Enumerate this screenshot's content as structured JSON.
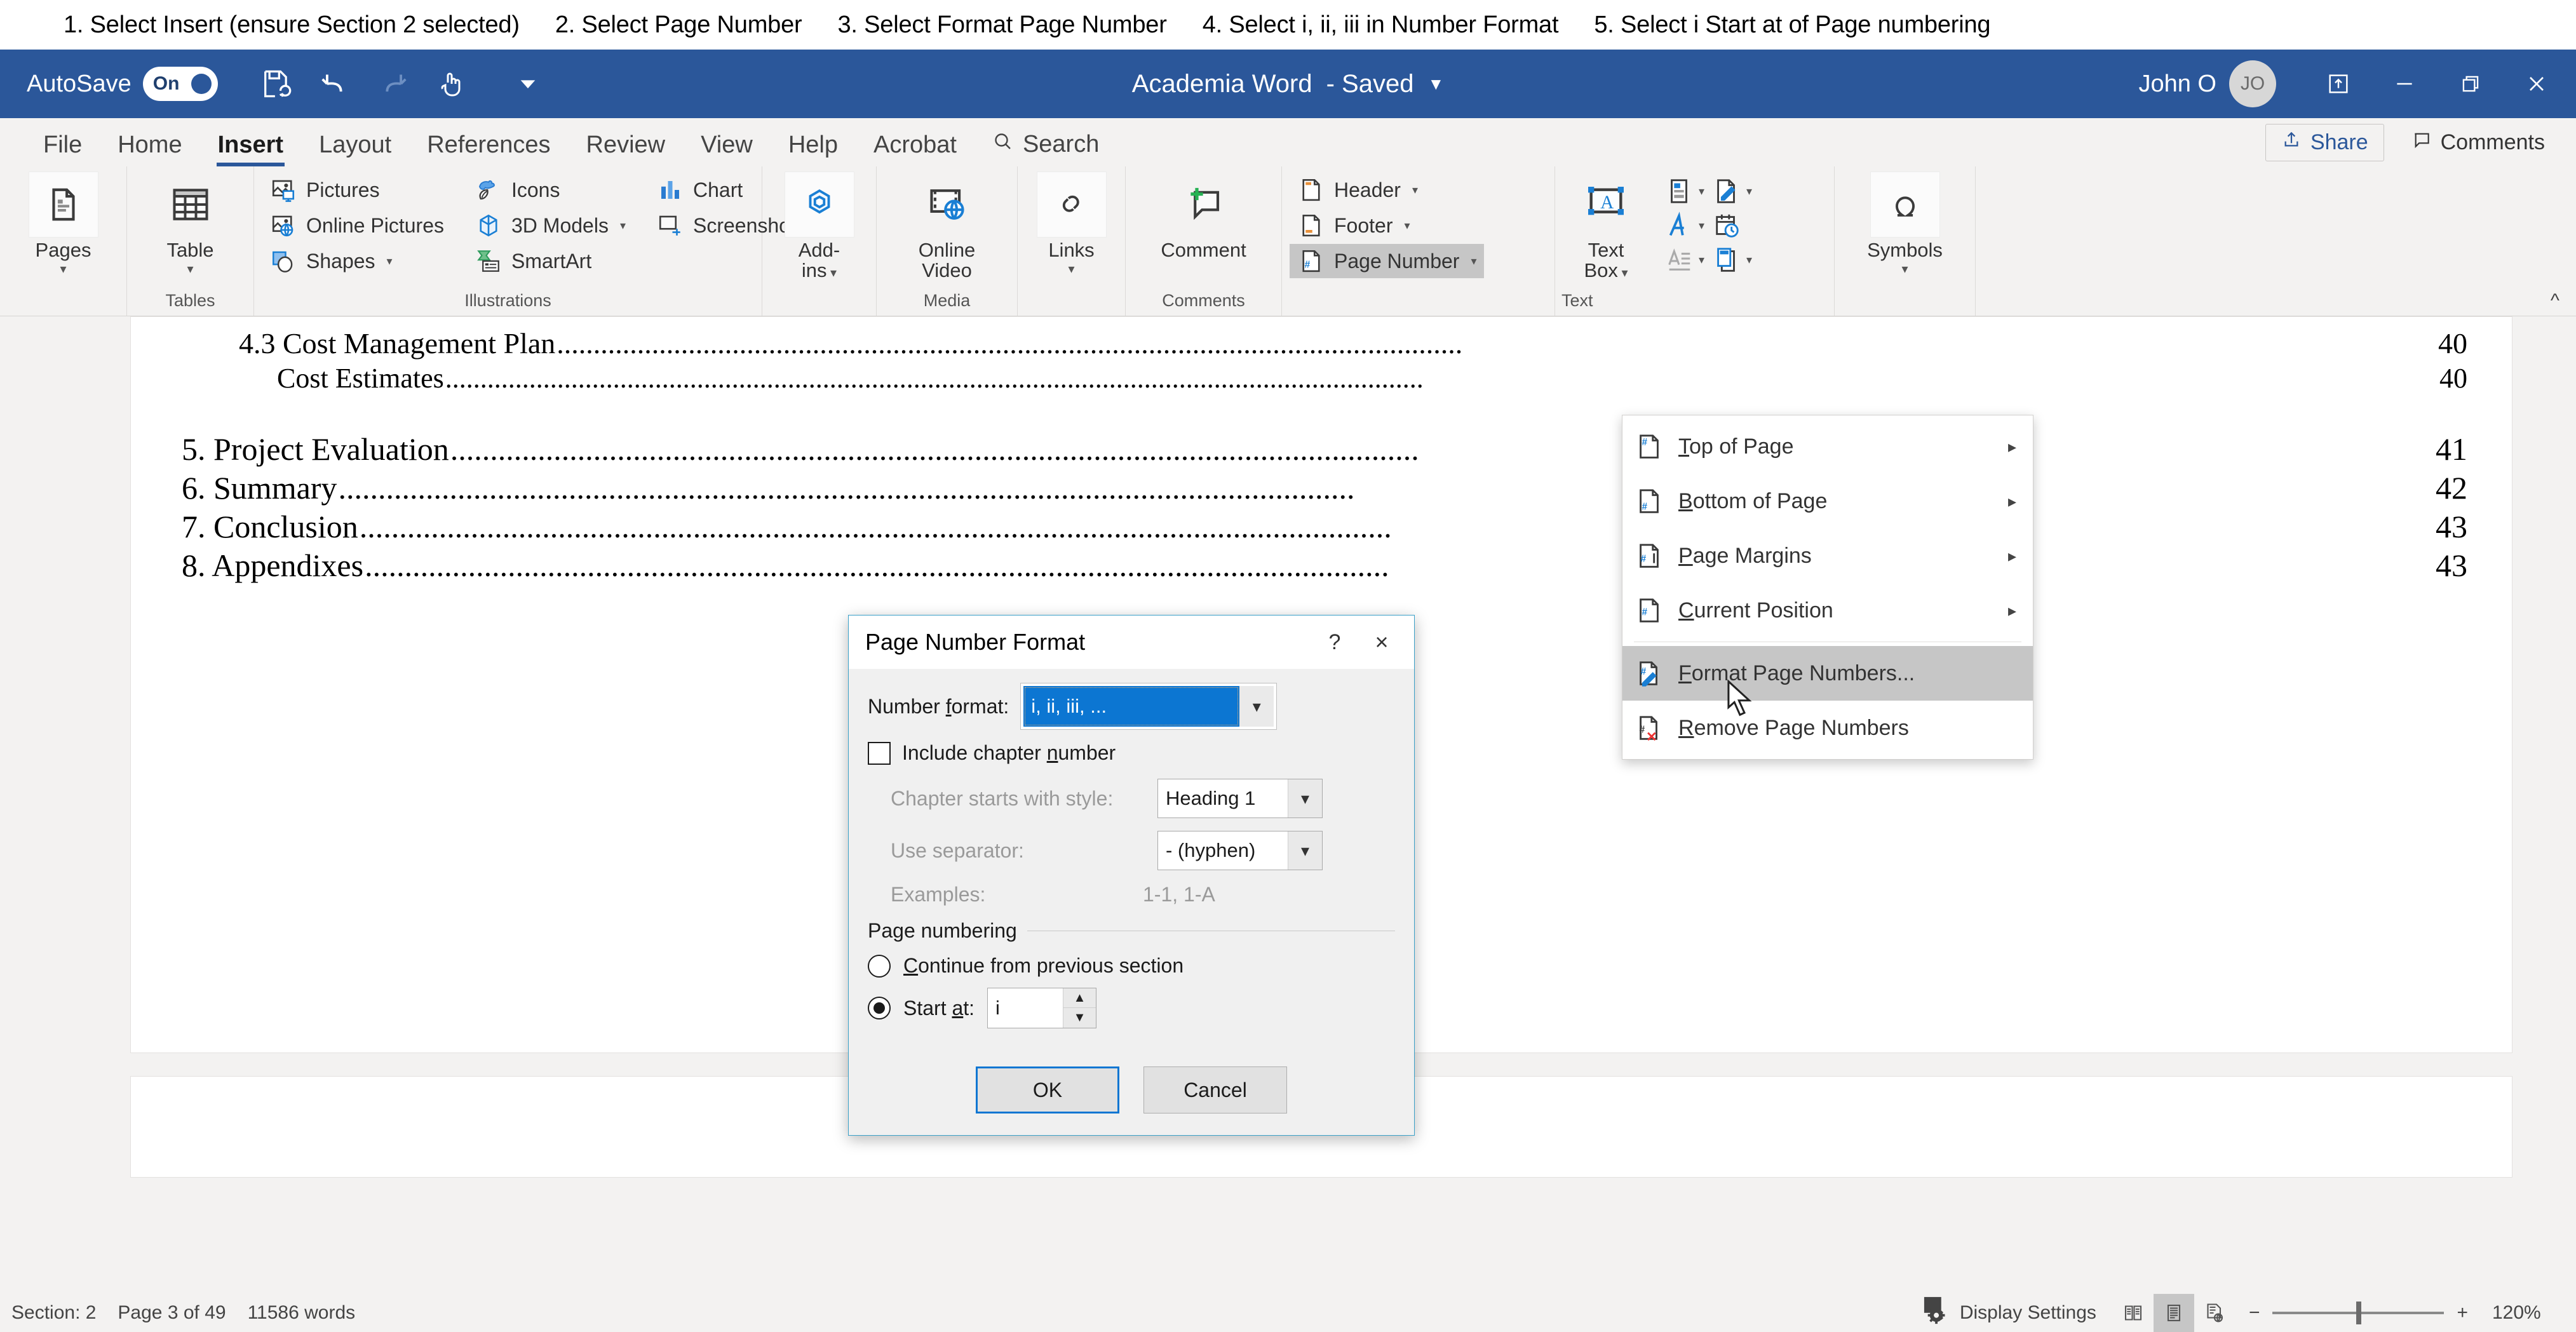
{
  "instructions": [
    "1. Select Insert (ensure Section 2 selected)",
    "2. Select Page Number",
    "3. Select Format Page Number",
    "4. Select i, ii, iii in Number Format",
    "5. Select i Start at of Page numbering"
  ],
  "titlebar": {
    "autosave_label": "AutoSave",
    "autosave_state": "On",
    "document_title": "Academia Word",
    "save_state": "- Saved",
    "user_name": "John O",
    "user_initials": "JO",
    "quick_access": [
      "save-icon",
      "undo-icon",
      "redo-icon",
      "touch-mode-icon",
      "customize-qat-icon"
    ],
    "window_buttons": [
      "ribbon-display-options-icon",
      "minimize-icon",
      "restore-icon",
      "close-icon"
    ]
  },
  "tabs": [
    {
      "label": "File",
      "active": false
    },
    {
      "label": "Home",
      "active": false
    },
    {
      "label": "Insert",
      "active": true
    },
    {
      "label": "Layout",
      "active": false
    },
    {
      "label": "References",
      "active": false
    },
    {
      "label": "Review",
      "active": false
    },
    {
      "label": "View",
      "active": false
    },
    {
      "label": "Help",
      "active": false
    },
    {
      "label": "Acrobat",
      "active": false
    }
  ],
  "search_label": "Search",
  "share_label": "Share",
  "comments_label": "Comments",
  "ribbon": {
    "groups": [
      {
        "label": "",
        "items": [
          {
            "label": "Pages",
            "icon": "pages-icon"
          }
        ]
      },
      {
        "label": "Tables",
        "items": [
          {
            "label": "Table",
            "icon": "table-icon"
          }
        ]
      },
      {
        "label": "Illustrations",
        "items": [
          {
            "label": "Pictures",
            "icon": "pictures-icon"
          },
          {
            "label": "Online Pictures",
            "icon": "online-pictures-icon"
          },
          {
            "label": "Shapes",
            "icon": "shapes-icon"
          },
          {
            "label": "Icons",
            "icon": "icons-icon"
          },
          {
            "label": "3D Models",
            "icon": "3d-models-icon"
          },
          {
            "label": "SmartArt",
            "icon": "smartart-icon"
          },
          {
            "label": "Chart",
            "icon": "chart-icon"
          },
          {
            "label": "Screenshot",
            "icon": "screenshot-icon"
          }
        ]
      },
      {
        "label": "",
        "items": [
          {
            "label": "Add-ins",
            "icon": "addins-icon"
          }
        ]
      },
      {
        "label": "Media",
        "items": [
          {
            "label": "Online Video",
            "icon": "online-video-icon"
          }
        ]
      },
      {
        "label": "",
        "items": [
          {
            "label": "Links",
            "icon": "links-icon"
          }
        ]
      },
      {
        "label": "Comments",
        "items": [
          {
            "label": "Comment",
            "icon": "comment-icon"
          }
        ]
      },
      {
        "label": "",
        "items": [
          {
            "label": "Header",
            "icon": "header-icon"
          },
          {
            "label": "Footer",
            "icon": "footer-icon"
          },
          {
            "label": "Page Number",
            "icon": "page-number-icon",
            "selected": true
          }
        ]
      },
      {
        "label": "Text",
        "items": [
          {
            "label": "Text Box",
            "icon": "text-box-icon"
          }
        ]
      },
      {
        "label": "",
        "items": [
          {
            "label": "Symbols",
            "icon": "omega-icon"
          }
        ]
      }
    ],
    "labels": {
      "pages": "Pages",
      "table": "Table",
      "tables_group": "Tables",
      "pictures": "Pictures",
      "online_pictures": "Online Pictures",
      "shapes": "Shapes",
      "icons": "Icons",
      "models3d": "3D Models",
      "smartart": "SmartArt",
      "chart": "Chart",
      "screenshot": "Screenshot",
      "illustrations_group": "Illustrations",
      "addins": "Add-­ins",
      "addins_l1": "Add-",
      "addins_l2": "ins",
      "online_video_l1": "Online",
      "online_video_l2": "Video",
      "media_group": "Media",
      "links": "Links",
      "comment": "Comment",
      "comments_group": "Comments",
      "header": "Header",
      "footer": "Footer",
      "page_number": "Page Number",
      "textbox_l1": "Text",
      "textbox_l2": "Box",
      "text_group": "Text",
      "symbols": "Symbols"
    }
  },
  "page_number_menu": {
    "items": [
      {
        "label": "Top of Page",
        "icon": "page-number-top-icon",
        "submenu": true,
        "selected": false
      },
      {
        "label": "Bottom of Page",
        "icon": "page-number-bottom-icon",
        "submenu": true,
        "selected": false
      },
      {
        "label": "Page Margins",
        "icon": "page-number-margins-icon",
        "submenu": true,
        "selected": false
      },
      {
        "label": "Current Position",
        "icon": "page-number-current-icon",
        "submenu": true,
        "selected": false
      },
      {
        "label": "Format Page Numbers...",
        "icon": "format-page-numbers-icon",
        "submenu": false,
        "selected": true
      },
      {
        "label": "Remove Page Numbers",
        "icon": "remove-page-numbers-icon",
        "submenu": false,
        "selected": false
      }
    ]
  },
  "dialog": {
    "title": "Page Number Format",
    "help_label": "?",
    "close_label": "×",
    "number_format_label": "Number format:",
    "number_format_value": "i, ii, iii, ...",
    "include_chapter_label": "Include chapter number",
    "include_chapter_checked": false,
    "chapter_style_label": "Chapter starts with style:",
    "chapter_style_value": "Heading 1",
    "separator_label": "Use separator:",
    "separator_value": "-    (hyphen)",
    "examples_label": "Examples:",
    "examples_value": "1-1, 1-A",
    "page_numbering_label": "Page numbering",
    "continue_label": "Continue from previous section",
    "start_at_label": "Start at:",
    "start_at_value": "i",
    "selected_option": "start_at",
    "ok_label": "OK",
    "cancel_label": "Cancel"
  },
  "document": {
    "toc": [
      {
        "level": 2,
        "text": "4.3 Cost Management Plan",
        "page": "40"
      },
      {
        "level": 3,
        "text": "Cost Estimates",
        "page": "40"
      },
      {
        "level": 1,
        "text": "5. Project Evaluation ",
        "page": "41"
      },
      {
        "level": 1,
        "text": "6. Summary ",
        "page": "42"
      },
      {
        "level": 1,
        "text": "7. Conclusion",
        "page": "43"
      },
      {
        "level": 1,
        "text": "8. Appendixes",
        "page": "43"
      }
    ]
  },
  "statusbar": {
    "section": "Section: 2",
    "page": "Page 3 of 49",
    "words": "11586 words",
    "display_settings": "Display Settings",
    "view_buttons": [
      "read-mode-icon",
      "print-layout-icon",
      "web-layout-icon"
    ],
    "active_view": "print-layout-icon",
    "zoom_out": "−",
    "zoom_in": "+",
    "zoom_level": "120%"
  }
}
